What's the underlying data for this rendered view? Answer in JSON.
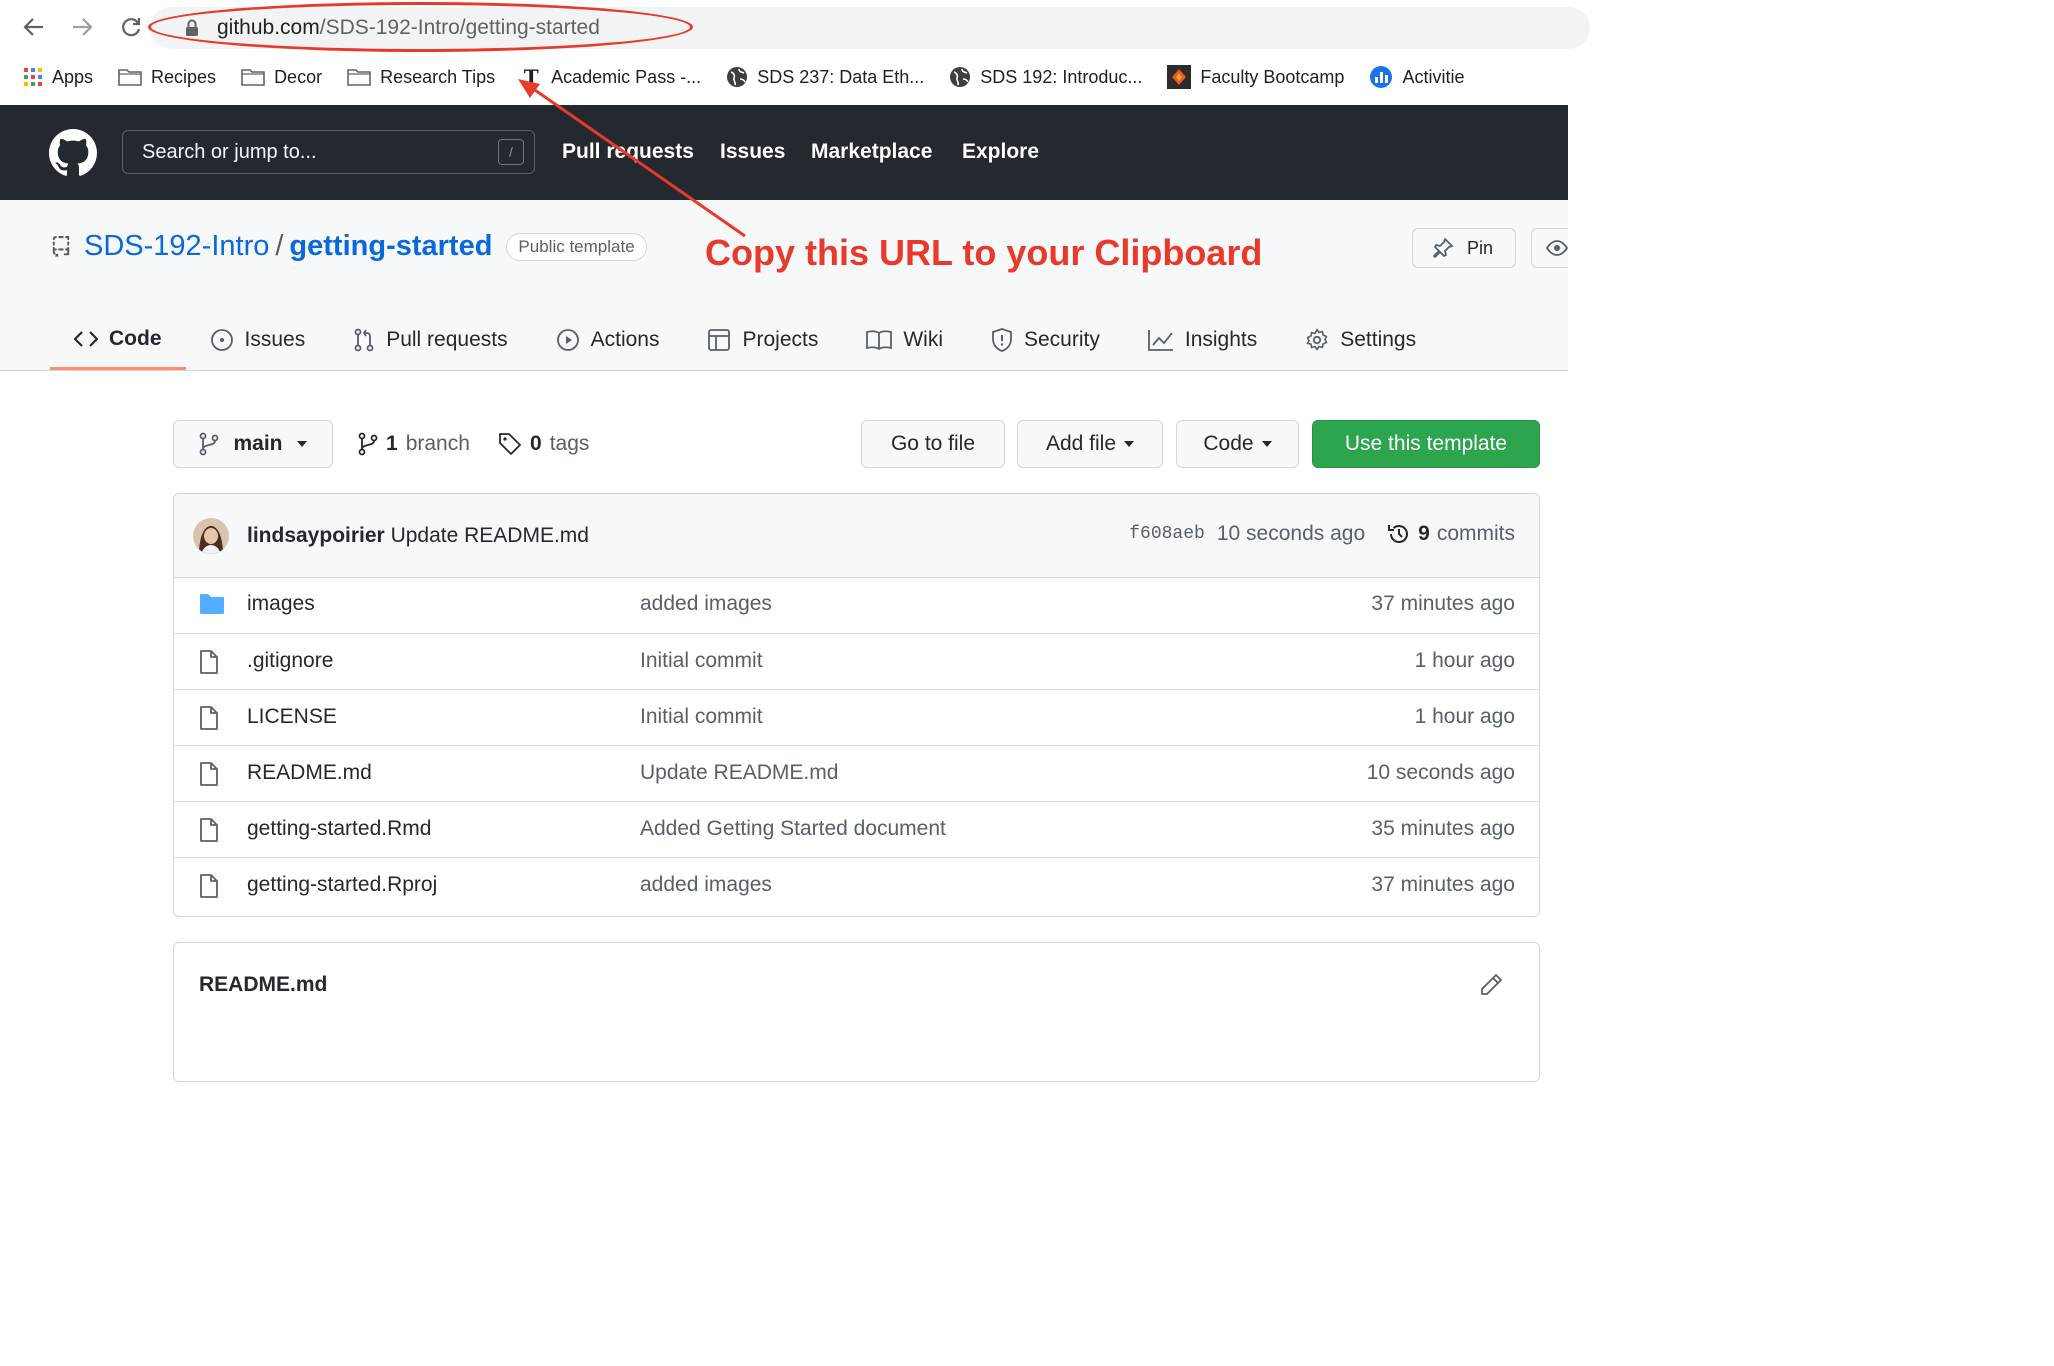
{
  "browser": {
    "url_host": "github.com",
    "url_path": "/SDS-192-Intro/getting-started",
    "bookmarks": [
      "Apps",
      "Recipes",
      "Decor",
      "Research Tips",
      "Academic Pass -...",
      "SDS 237: Data Eth...",
      "SDS 192: Introduc...",
      "Faculty Bootcamp",
      "Activitie"
    ]
  },
  "gh_header": {
    "search_placeholder": "Search or jump to...",
    "slash_key": "/",
    "links": [
      "Pull requests",
      "Issues",
      "Marketplace",
      "Explore"
    ]
  },
  "repo": {
    "owner": "SDS-192-Intro",
    "separator": "/",
    "name": "getting-started",
    "badge": "Public template",
    "pin_label": "Pin"
  },
  "annotation": {
    "text": "Copy this URL to your Clipboard",
    "color": "#e8392a"
  },
  "tabs": [
    "Code",
    "Issues",
    "Pull requests",
    "Actions",
    "Projects",
    "Wiki",
    "Security",
    "Insights",
    "Settings"
  ],
  "file_nav": {
    "branch": "main",
    "branch_count": "1",
    "branch_label": "branch",
    "tag_count": "0",
    "tag_label": "tags",
    "go_to_file": "Go to file",
    "add_file": "Add file",
    "code": "Code",
    "use_template": "Use this template",
    "accent": "#2da44e"
  },
  "latest_commit": {
    "author": "lindsaypoirier",
    "message": "Update README.md",
    "sha": "f608aeb",
    "age": "10 seconds ago",
    "commit_count": "9",
    "commit_label": "commits"
  },
  "files": [
    {
      "name": "images",
      "message": "added images",
      "age": "37 minutes ago",
      "type": "folder"
    },
    {
      "name": ".gitignore",
      "message": "Initial commit",
      "age": "1 hour ago",
      "type": "file"
    },
    {
      "name": "LICENSE",
      "message": "Initial commit",
      "age": "1 hour ago",
      "type": "file"
    },
    {
      "name": "README.md",
      "message": "Update README.md",
      "age": "10 seconds ago",
      "type": "file"
    },
    {
      "name": "getting-started.Rmd",
      "message": "Added Getting Started document",
      "age": "35 minutes ago",
      "type": "file"
    },
    {
      "name": "getting-started.Rproj",
      "message": "added images",
      "age": "37 minutes ago",
      "type": "file"
    }
  ],
  "readme": {
    "title": "README.md"
  }
}
